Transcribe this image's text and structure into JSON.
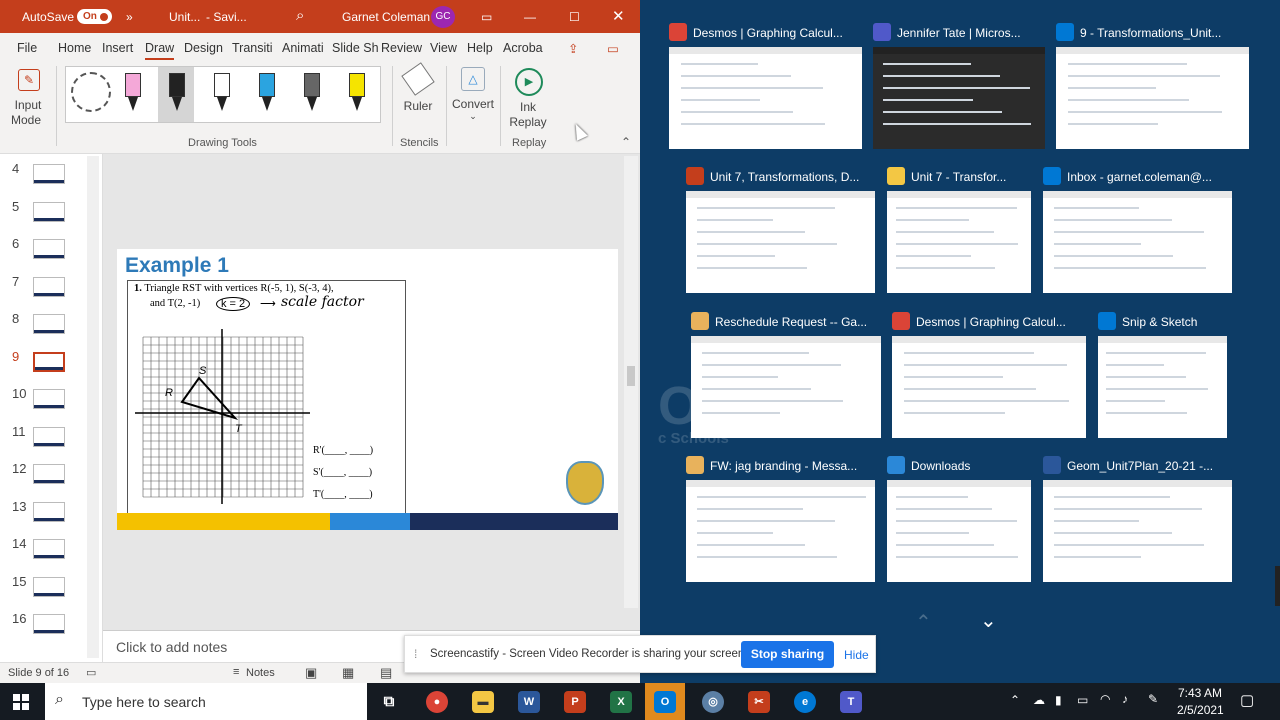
{
  "colors": {
    "ppt_accent": "#c43e1c",
    "taskview_bg": "#0d3c66",
    "taskbar_bg": "#151b22"
  },
  "titlebar": {
    "autosave_label": "AutoSave",
    "autosave_state": "On",
    "doc_name": "Unit...",
    "save_status": "- Savi...",
    "user_name": "Garnet Coleman",
    "user_initials": "GC"
  },
  "tabs": [
    "File",
    "Home",
    "Insert",
    "Draw",
    "Design",
    "Transiti",
    "Animati",
    "Slide Sh",
    "Review",
    "View",
    "Help",
    "Acroba"
  ],
  "ribbon": {
    "input_mode": "Input",
    "input_mode2": "Mode",
    "drawing_tools": "Drawing Tools",
    "ruler": "Ruler",
    "convert": "Convert",
    "ink_replay": "Ink",
    "ink_replay2": "Replay",
    "group_stencils": "Stencils",
    "group_replay": "Replay"
  },
  "pen_colors": [
    "#f4a8d8",
    "#222222",
    "#ffffff",
    "#2ba4e0",
    "#666666",
    "#f5e400"
  ],
  "thumbs": [
    "4",
    "5",
    "6",
    "7",
    "8",
    "9",
    "10",
    "11",
    "12",
    "13",
    "14",
    "15",
    "16"
  ],
  "selected_slide": "9",
  "slide": {
    "title": "Example 1",
    "problem_num": "1.",
    "problem_text": "Triangle RST with vertices R(-5, 1), S(-3, 4),",
    "problem_text2": "and T(2, -1)",
    "k_label": "k = 2",
    "scale_note": "scale factor",
    "label_s": "S",
    "label_r": "R",
    "label_t": "T",
    "answers": [
      "R'(____, ____)",
      "S'(____, ____)",
      "T'(____, ____)"
    ]
  },
  "notes_placeholder": "Click to add notes",
  "status": {
    "slide_info": "Slide 9 of 16",
    "notes_label": "Notes"
  },
  "task_windows": [
    {
      "title": "Desmos | Graphing Calcul...",
      "icon": "chrome-icon",
      "color": "#db4437"
    },
    {
      "title": "Jennifer Tate | Micros...",
      "icon": "teams-icon",
      "color": "#5059c9"
    },
    {
      "title": "9 - Transformations_Unit...",
      "icon": "edge-icon",
      "color": "#0078d4"
    },
    {
      "title": "Unit 7, Transformations, D...",
      "icon": "powerpoint-icon",
      "color": "#c43e1c"
    },
    {
      "title": "Unit 7 - Transfor...",
      "icon": "folder-icon",
      "color": "#f3c744"
    },
    {
      "title": "Inbox - garnet.coleman@...",
      "icon": "outlook-icon",
      "color": "#0078d4"
    },
    {
      "title": "Reschedule Request -- Ga...",
      "icon": "mail-icon",
      "color": "#e8b25c"
    },
    {
      "title": "Desmos | Graphing Calcul...",
      "icon": "chrome-icon",
      "color": "#db4437"
    },
    {
      "title": "Snip & Sketch",
      "icon": "snip-icon",
      "color": "#0078d4"
    },
    {
      "title": "FW: jag branding - Messa...",
      "icon": "mail-icon",
      "color": "#e8b25c"
    },
    {
      "title": "Downloads",
      "icon": "download-icon",
      "color": "#2b88d8"
    },
    {
      "title": "Geom_Unit7Plan_20-21 -...",
      "icon": "word-icon",
      "color": "#2b579a"
    }
  ],
  "banner": {
    "text": "Screencastify - Screen Video Recorder is sharing your screen.",
    "stop": "Stop sharing",
    "hide": "Hide"
  },
  "taskbar": {
    "search_placeholder": "Type here to search",
    "time": "7:43 AM",
    "date": "2/5/2021"
  },
  "background_text": {
    "big": "OE",
    "sub": "c Schools"
  }
}
